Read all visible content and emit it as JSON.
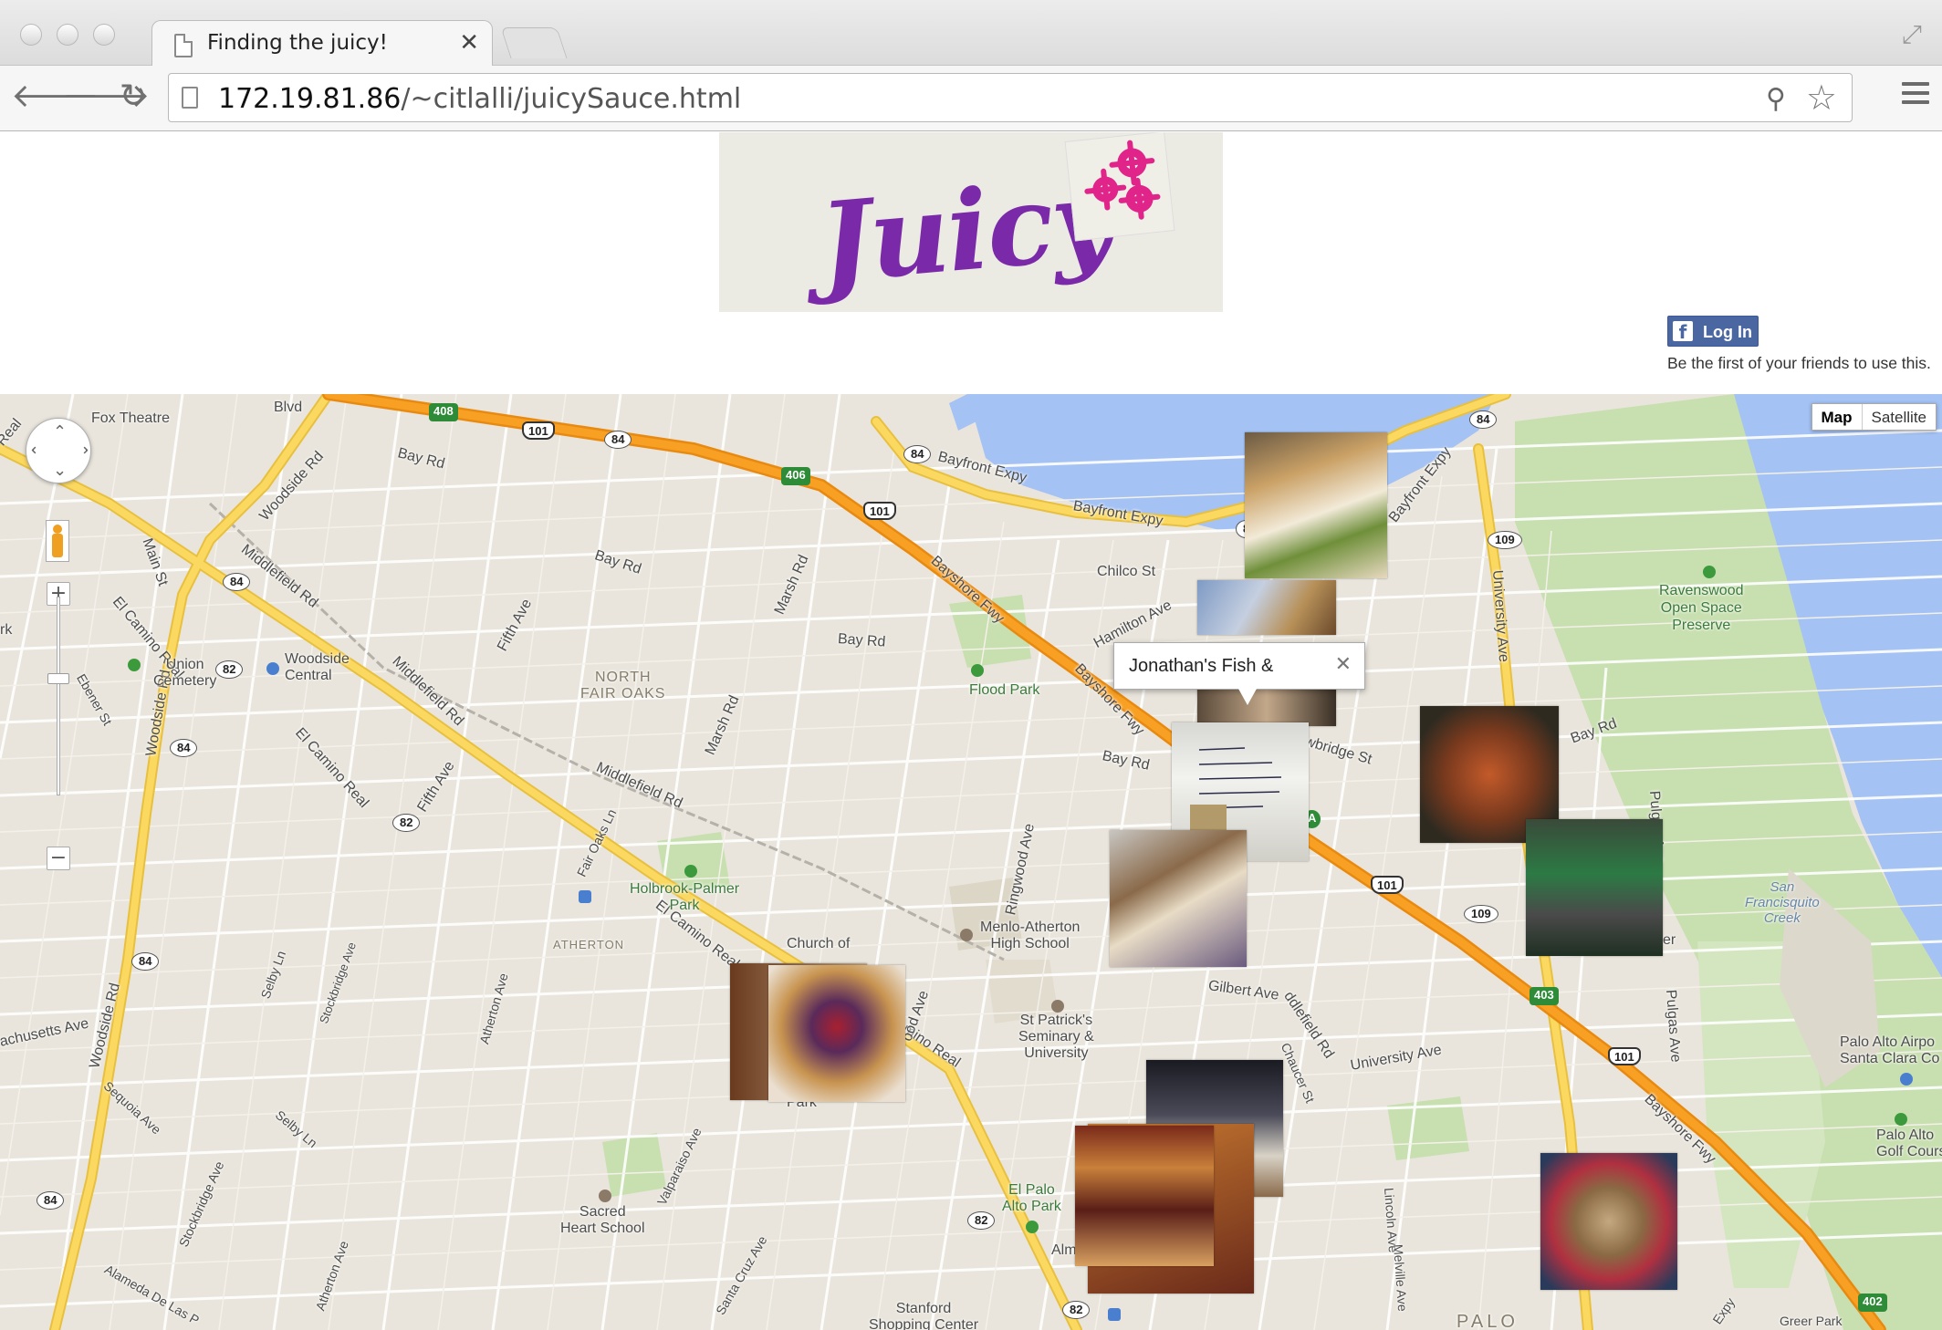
{
  "browser": {
    "tab_title": "Finding the juicy!",
    "tab_close": "✕",
    "url_host": "172.19.81.86",
    "url_path": "/~citlalli/juicySauce.html",
    "back_icon": "🡐",
    "forward_icon": "🡒",
    "reload_icon": "↻",
    "search_icon": "⚲",
    "star_icon": "☆",
    "fullscreen_icon": "⤢"
  },
  "header": {
    "logo_text": "Juicy"
  },
  "facebook": {
    "f_letter": "f",
    "login_label": "Log In",
    "social_text": "Be the first of your friends to use this."
  },
  "map": {
    "map_type": {
      "map_label": "Map",
      "satellite_label": "Satellite"
    },
    "zoom_in": "+",
    "zoom_out": "−",
    "info_window": {
      "title": "Jonathan's Fish &",
      "close": "✕"
    },
    "labels": {
      "fox_theatre": "Fox Theatre",
      "bay_rd_1": "Bay Rd",
      "bay_rd_2": "Bay Rd",
      "bay_rd_3": "Bay Rd",
      "bay_rd_4": "Bay Rd",
      "bay_rd_5": "Bay Rd",
      "bayfront_expy_1": "Bayfront Expy",
      "bayfront_expy_2": "Bayfront Expy",
      "bayfront_expy_3": "Bayfront Expy",
      "bayshore_fwy_1": "Bayshore Fwy",
      "bayshore_fwy_2": "Bayshore Fwy",
      "bayshore_fwy_3": "Bayshore Fwy",
      "woodside_rd_1": "Woodside Rd",
      "woodside_rd_2": "Woodside Rd",
      "woodside_rd_3": "Woodside Rd",
      "middlefield_rd_1": "Middlefield Rd",
      "middlefield_rd_2": "Middlefield Rd",
      "middlefield_rd_3": "Middlefield Rd",
      "middlefield_rd_4": "ddlefield Rd",
      "main_st": "Main St",
      "el_camino_1": "El Camino Real",
      "el_camino_2": "El Camino Real",
      "el_camino_3": "El Camino Real",
      "el_camino_4": "El Camino Real",
      "union_cemetery": "Union\nCemetery",
      "woodside_central": "Woodside\nCentral",
      "ebener_st": "Ebener St",
      "fifth_ave_1": "Fifth Ave",
      "fifth_ave_2": "Fifth Ave",
      "north_fair_oaks": "NORTH\nFAIR OAKS",
      "marsh_rd_1": "Marsh Rd",
      "marsh_rd_2": "Marsh Rd",
      "chilco_st": "Chilco St",
      "hamilton_ave": "Hamilton Ave",
      "flood_park": "Flood Park",
      "ravenswood": "Ravenswood\nOpen Space\nPreserve",
      "university_ave_1": "University Ave",
      "university_ave_2": "University Ave",
      "willow_rd": "wbridge St",
      "pulgas_ave_1": "Pulgas Ave",
      "pulgas_ave_2": "Pulgas Ave",
      "fair_oaks_ln": "Fair Oaks Ln",
      "holbrook_palmer": "Holbrook-Palmer\nPark",
      "ringwood_ave": "Ringwood Ave",
      "menlo_atherton": "Menlo-Atherton\nHigh School",
      "atherton_district": "ATHERTON",
      "selby_ln_1": "Selby Ln",
      "selby_ln_2": "Selby Ln",
      "stockbridge_ave_1": "Stockbridge Ave",
      "stockbridge_ave_2": "Stockbridge Ave",
      "atherton_ave_1": "Atherton Ave",
      "atherton_ave_2": "Atherton Ave",
      "church": "Church of",
      "wood_ave": "ood Ave",
      "gilbert_ave": "Gilbert Ave",
      "st_patricks": "St Patrick's\nSeminary &\nUniversity",
      "chaucer_st": "Chaucer St",
      "san_francisquito": "San\nFrancisquito\nCreek",
      "palo_alto_airport": "Palo Alto Airpo\nSanta Clara Co",
      "palo_alto_golf": "Palo Alto\nGolf Cours",
      "massachusetts_ave": "achusetts Ave",
      "sequoia_ave": "Sequoia Ave",
      "valparaiso_ave": "Valparaiso Ave",
      "santa_cruz_ave": "Santa Cruz Ave",
      "sacred_heart": "Sacred\nHeart School",
      "el_palo_alto_park": "El Palo\nAlto Park",
      "alameda": "Alameda De Las P",
      "stanford_shopping": "Stanford\nShopping Center",
      "lincoln_ave": "Lincoln Ave",
      "melville_ave": "Melville Ave",
      "palo": "PALO",
      "park_label": "Park",
      "alm": "Alm",
      "er": "er",
      "blvd": "Blvd",
      "rk": "rk",
      "expy": "Expy",
      "greer_park": "Greer Park",
      "real_w": "Real"
    },
    "shields": {
      "s408": "408",
      "s101a": "101",
      "s84a": "84",
      "s406": "406",
      "s84b": "84",
      "s101b": "101",
      "s84c": "84",
      "s109a": "109",
      "s84d": "84",
      "s82a": "82",
      "s84e": "84",
      "s82b": "82",
      "s101c": "101",
      "s109b": "109",
      "s84f": "84",
      "s403": "403",
      "s101d": "101",
      "s84g": "84",
      "s82c": "82",
      "s82d": "82",
      "s402": "402",
      "sA": "A",
      "s8": "8"
    }
  },
  "colors": {
    "water": "#a4c2f4",
    "park": "#c8dfb0",
    "freeway": "#f8a024",
    "arterial": "#fbd860",
    "map_bg": "#e9e5dc",
    "logo_purple": "#7a2aa8",
    "fb_blue": "#4b67a1"
  }
}
